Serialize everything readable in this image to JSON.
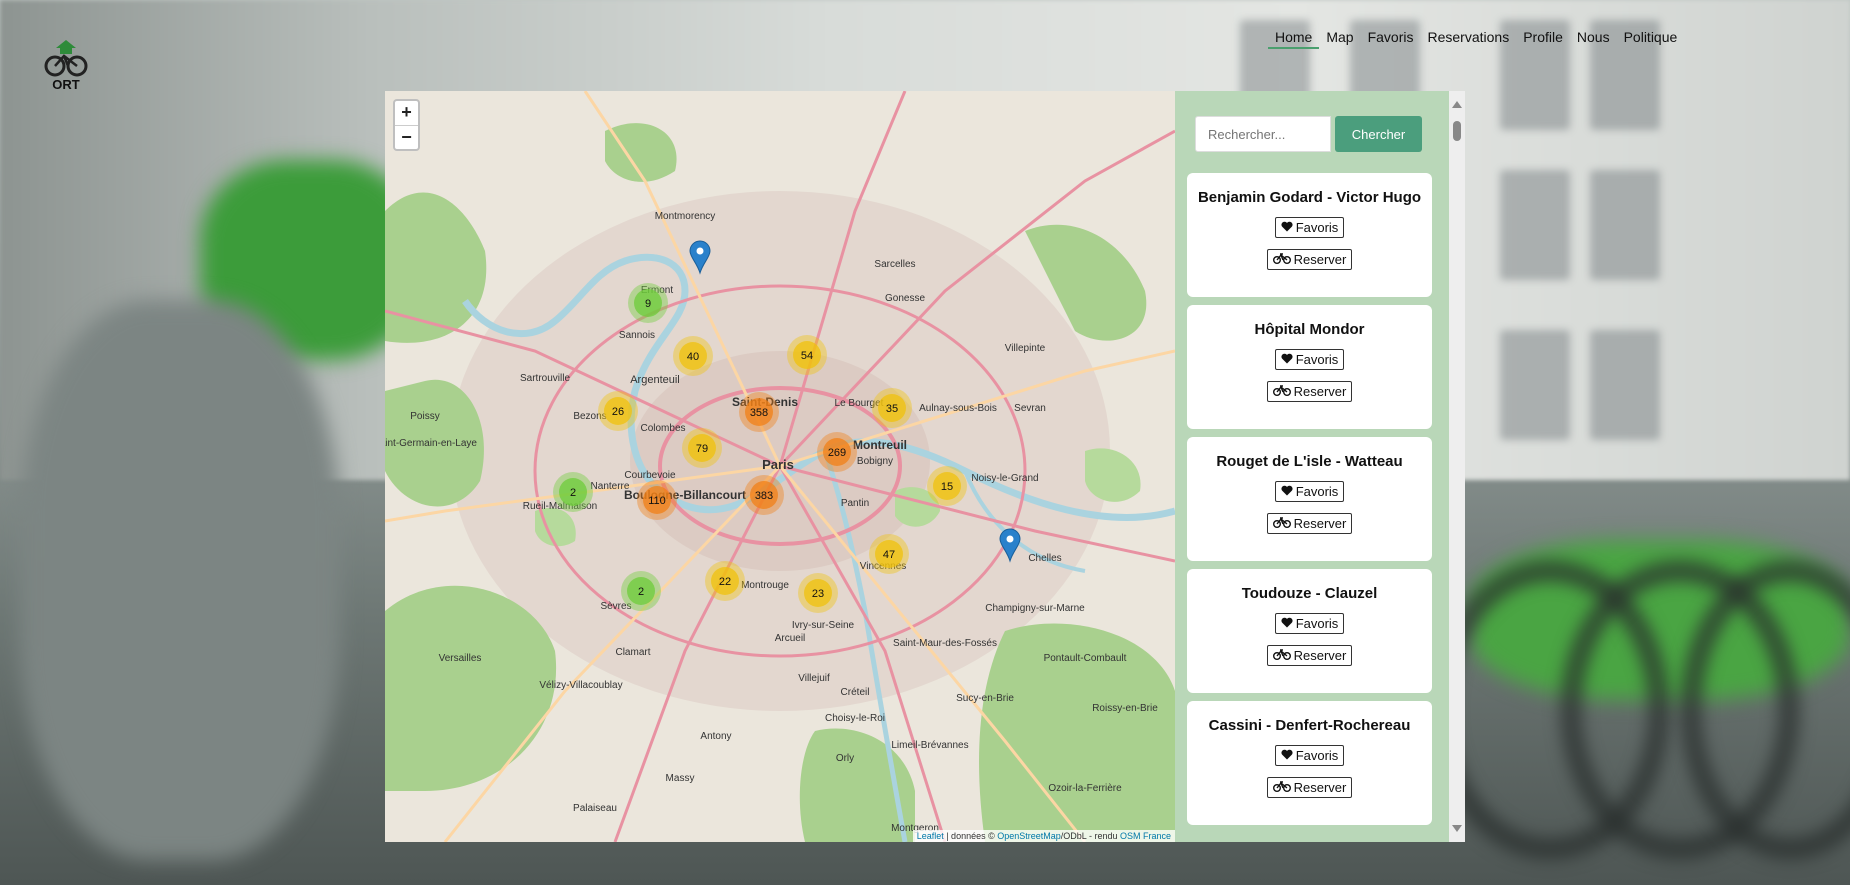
{
  "nav": {
    "logo_text": "ORT",
    "items": [
      {
        "label": "Home",
        "active": true
      },
      {
        "label": "Map",
        "active": false
      },
      {
        "label": "Favoris",
        "active": false
      },
      {
        "label": "Reservations",
        "active": false
      },
      {
        "label": "Profile",
        "active": false
      },
      {
        "label": "Nous",
        "active": false
      },
      {
        "label": "Politique",
        "active": false
      }
    ]
  },
  "map": {
    "zoom_in": "+",
    "zoom_out": "−",
    "attribution": {
      "leaflet": "Leaflet",
      "middle": " | données © ",
      "osm": "OpenStreetMap",
      "after": "/ODbL - rendu ",
      "osmfr": "OSM France"
    },
    "places": [
      "Paris",
      "Saint-Denis",
      "Montreuil",
      "Boulogne-Billancourt",
      "Argenteuil",
      "Colombes",
      "Nanterre",
      "Courbevoie",
      "Vincennes",
      "Ivry-sur-Seine",
      "Montrouge",
      "Créteil",
      "Bobigny",
      "Pantin",
      "Arcueil",
      "Clamart",
      "Sèvres",
      "Orly",
      "Antony",
      "Villejuif",
      "Sannois",
      "Bezons",
      "Sartrouville",
      "Rueil-Malmaison",
      "Saint-Germain-en-Laye",
      "Versailles",
      "Massy",
      "Noisy-le-Grand",
      "Chelles",
      "Sucy-en-Brie",
      "Le Bourget",
      "Aulnay-sous-Bois",
      "Sevran",
      "Villepinte",
      "Gonesse",
      "Sarcelles",
      "Montmorency",
      "Ermont",
      "Poissy",
      "Vélizy-Villacoublay",
      "Palaiseau",
      "Choisy-le-Roi",
      "Limeil-Brévannes",
      "Montgeron",
      "Ozoir-la-Ferrière",
      "Pontault-Combault",
      "Roissy-en-Brie",
      "Champigny-sur-Marne",
      "Saint-Maur-des-Fossés"
    ],
    "clusters": [
      {
        "count": "9",
        "level": "small"
      },
      {
        "count": "40",
        "level": "medium"
      },
      {
        "count": "54",
        "level": "medium"
      },
      {
        "count": "358",
        "level": "large"
      },
      {
        "count": "26",
        "level": "medium"
      },
      {
        "count": "35",
        "level": "medium"
      },
      {
        "count": "79",
        "level": "medium"
      },
      {
        "count": "269",
        "level": "large"
      },
      {
        "count": "2",
        "level": "small"
      },
      {
        "count": "110",
        "level": "large"
      },
      {
        "count": "383",
        "level": "large"
      },
      {
        "count": "15",
        "level": "medium"
      },
      {
        "count": "47",
        "level": "medium"
      },
      {
        "count": "2",
        "level": "small"
      },
      {
        "count": "22",
        "level": "medium"
      },
      {
        "count": "23",
        "level": "medium"
      }
    ],
    "colors": {
      "small": "#6ecc39",
      "medium": "#f0c20c",
      "large": "#f18017"
    }
  },
  "sidebar": {
    "search_placeholder": "Rechercher...",
    "search_button": "Chercher",
    "favoris_label": "Favoris",
    "reserver_label": "Reserver",
    "stations": [
      {
        "name": "Benjamin Godard - Victor Hugo"
      },
      {
        "name": "Hôpital Mondor"
      },
      {
        "name": "Rouget de L'isle - Watteau"
      },
      {
        "name": "Toudouze - Clauzel"
      },
      {
        "name": "Cassini - Denfert-Rochereau"
      }
    ]
  }
}
